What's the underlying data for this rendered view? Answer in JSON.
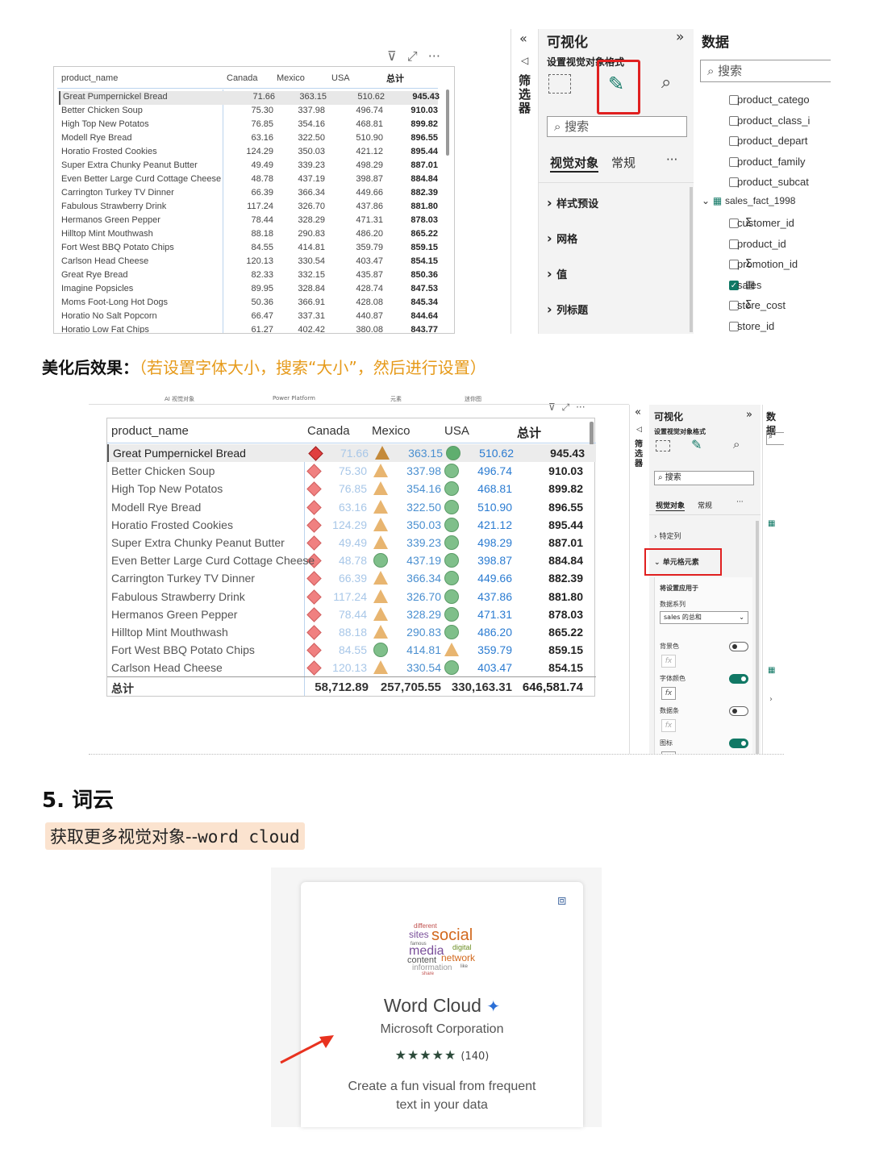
{
  "shot1": {
    "table": {
      "headers": [
        "product_name",
        "Canada",
        "Mexico",
        "USA",
        "总计"
      ],
      "rows": [
        [
          "Great Pumpernickel Bread",
          "71.66",
          "363.15",
          "510.62",
          "945.43"
        ],
        [
          "Better Chicken Soup",
          "75.30",
          "337.98",
          "496.74",
          "910.03"
        ],
        [
          "High Top New Potatos",
          "76.85",
          "354.16",
          "468.81",
          "899.82"
        ],
        [
          "Modell Rye Bread",
          "63.16",
          "322.50",
          "510.90",
          "896.55"
        ],
        [
          "Horatio Frosted Cookies",
          "124.29",
          "350.03",
          "421.12",
          "895.44"
        ],
        [
          "Super Extra Chunky Peanut Butter",
          "49.49",
          "339.23",
          "498.29",
          "887.01"
        ],
        [
          "Even Better Large Curd Cottage Cheese",
          "48.78",
          "437.19",
          "398.87",
          "884.84"
        ],
        [
          "Carrington Turkey TV Dinner",
          "66.39",
          "366.34",
          "449.66",
          "882.39"
        ],
        [
          "Fabulous Strawberry Drink",
          "117.24",
          "326.70",
          "437.86",
          "881.80"
        ],
        [
          "Hermanos Green Pepper",
          "78.44",
          "328.29",
          "471.31",
          "878.03"
        ],
        [
          "Hilltop Mint Mouthwash",
          "88.18",
          "290.83",
          "486.20",
          "865.22"
        ],
        [
          "Fort West BBQ Potato Chips",
          "84.55",
          "414.81",
          "359.79",
          "859.15"
        ],
        [
          "Carlson Head Cheese",
          "120.13",
          "330.54",
          "403.47",
          "854.15"
        ],
        [
          "Great Rye Bread",
          "82.33",
          "332.15",
          "435.87",
          "850.36"
        ],
        [
          "Imagine Popsicles",
          "89.95",
          "328.84",
          "428.74",
          "847.53"
        ],
        [
          "Moms Foot-Long Hot Dogs",
          "50.36",
          "366.91",
          "428.08",
          "845.34"
        ],
        [
          "Horatio No Salt Popcorn",
          "66.47",
          "337.31",
          "440.87",
          "844.64"
        ],
        [
          "Horatio Low Fat Chips",
          "61.27",
          "402.42",
          "380.08",
          "843.77"
        ]
      ]
    },
    "pane": {
      "filters_label": "筛选器",
      "vis_title": "可视化",
      "format_label": "设置视觉对象格式",
      "search_placeholder": "搜索",
      "tab_visual": "视觉对象",
      "tab_general": "常规",
      "more": "···",
      "sections": [
        "样式预设",
        "网格",
        "值",
        "列标题"
      ],
      "data_title": "数据",
      "data_search": "搜索",
      "fields": [
        {
          "name": "product_catego",
          "checked": false,
          "sigma": false
        },
        {
          "name": "product_class_i",
          "checked": false,
          "sigma": false
        },
        {
          "name": "product_depart",
          "checked": false,
          "sigma": false
        },
        {
          "name": "product_family",
          "checked": false,
          "sigma": false
        },
        {
          "name": "product_subcat",
          "checked": false,
          "sigma": false
        }
      ],
      "table_name": "sales_fact_1998",
      "table_fields": [
        {
          "name": "customer_id",
          "checked": false,
          "sigma": true
        },
        {
          "name": "product_id",
          "checked": false,
          "sigma": false
        },
        {
          "name": "promotion_id",
          "checked": false,
          "sigma": true
        },
        {
          "name": "sales",
          "checked": true,
          "sigma": false
        },
        {
          "name": "store_cost",
          "checked": false,
          "sigma": true
        },
        {
          "name": "store_id",
          "checked": false,
          "sigma": false
        }
      ]
    }
  },
  "caption": {
    "main": "美化后效果：",
    "note": "（若设置字体大小，搜索“大小”，然后进行设置）"
  },
  "shot2": {
    "menu": [
      "AI 视觉对象",
      "Power Platform",
      "元素",
      "迷你图"
    ],
    "headers": [
      "product_name",
      "Canada",
      "Mexico",
      "USA",
      "总计"
    ],
    "rows": [
      [
        "Great Pumpernickel Bread",
        "71.66",
        "363.15",
        "510.62",
        "945.43"
      ],
      [
        "Better Chicken Soup",
        "75.30",
        "337.98",
        "496.74",
        "910.03"
      ],
      [
        "High Top New Potatos",
        "76.85",
        "354.16",
        "468.81",
        "899.82"
      ],
      [
        "Modell Rye Bread",
        "63.16",
        "322.50",
        "510.90",
        "896.55"
      ],
      [
        "Horatio Frosted Cookies",
        "124.29",
        "350.03",
        "421.12",
        "895.44"
      ],
      [
        "Super Extra Chunky Peanut Butter",
        "49.49",
        "339.23",
        "498.29",
        "887.01"
      ],
      [
        "Even Better Large Curd Cottage Cheese",
        "48.78",
        "437.19",
        "398.87",
        "884.84"
      ],
      [
        "Carrington Turkey TV Dinner",
        "66.39",
        "366.34",
        "449.66",
        "882.39"
      ],
      [
        "Fabulous Strawberry Drink",
        "117.24",
        "326.70",
        "437.86",
        "881.80"
      ],
      [
        "Hermanos Green Pepper",
        "78.44",
        "328.29",
        "471.31",
        "878.03"
      ],
      [
        "Hilltop Mint Mouthwash",
        "88.18",
        "290.83",
        "486.20",
        "865.22"
      ],
      [
        "Fort West BBQ Potato Chips",
        "84.55",
        "414.81",
        "359.79",
        "859.15"
      ],
      [
        "Carlson Head Cheese",
        "120.13",
        "330.54",
        "403.47",
        "854.15"
      ]
    ],
    "mexico_icons": [
      "tri",
      "tri",
      "tri",
      "tri",
      "tri",
      "tri",
      "circle",
      "tri",
      "tri",
      "tri",
      "tri",
      "circle",
      "tri"
    ],
    "usa_icons": [
      "circle",
      "circle",
      "circle",
      "circle",
      "circle",
      "circle",
      "circle",
      "circle",
      "circle",
      "circle",
      "circle",
      "tri",
      "circle"
    ],
    "totals": [
      "总计",
      "58,712.89",
      "257,705.55",
      "330,163.31",
      "646,581.74"
    ],
    "pane": {
      "vis_title": "可视化",
      "data_title": "数据",
      "filters_label": "筛选器",
      "format_label": "设置视觉对象格式",
      "search": "搜索",
      "tab_visual": "视觉对象",
      "tab_general": "常规",
      "more": "···",
      "sec_specific": "特定列",
      "sec_cell": "单元格元素",
      "apply_to": "将设置应用于",
      "series_label": "数据系列",
      "series_value": "sales 的总和",
      "bg_color": "背景色",
      "font_color": "字体颜色",
      "data_bars": "数据条",
      "icons": "图标",
      "fx": "fx"
    }
  },
  "section5": {
    "title": "5. 词云",
    "sub_cn": "获取更多视觉对象--",
    "sub_en": "word cloud"
  },
  "card": {
    "cloud_words": [
      "different",
      "sites",
      "social",
      "famous",
      "media",
      "digital",
      "content",
      "network",
      "information",
      "like",
      "share"
    ],
    "name": "Word Cloud",
    "publisher": "Microsoft Corporation",
    "stars": "★★★★★",
    "count": "(140)",
    "rating": 4.5,
    "desc_line1": "Create a fun visual from frequent",
    "desc_line2": "text in your data"
  }
}
